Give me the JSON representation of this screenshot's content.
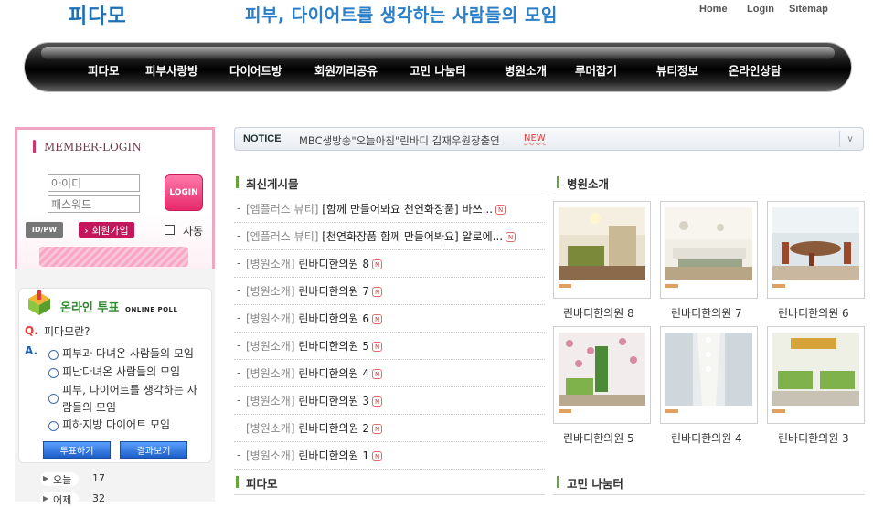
{
  "header": {
    "logo": "피다모",
    "slogan": "피부, 다이어트를 생각하는 사람들의 모임",
    "links": [
      "Home",
      "Login",
      "Sitemap"
    ]
  },
  "nav": [
    "피다모",
    "피부사랑방",
    "다이어트방",
    "회원끼리공유",
    "고민 나눔터",
    "병원소개",
    "루머잡기",
    "뷰티정보",
    "온라인상담"
  ],
  "login": {
    "title": "MEMBER-LOGIN",
    "id_placeholder": "아이디",
    "pw_placeholder": "패스워드",
    "login_button": "LOGIN",
    "idpw_button": "ID/PW",
    "join_button": "› 회원가입",
    "auto_label": "자동"
  },
  "poll": {
    "title": "온라인 투표",
    "subtitle": "ONLINE POLL",
    "q_mark": "Q.",
    "a_mark": "A.",
    "question": "피다모란?",
    "options": [
      "피부과 다녀온 사람들의 모임",
      "피난다녀온 사람들의 모임",
      "피부, 다이어트를 생각하는 사",
      "람들의 모임",
      "피하지방 다이어트 모임"
    ],
    "vote_button": "투표하기",
    "result_button": "결과보기"
  },
  "stats": {
    "today_label": "오늘",
    "today_value": "17",
    "yesterday_label": "어제",
    "yesterday_value": "32"
  },
  "notice": {
    "label": "NOTICE",
    "text": "MBC생방송\"오늘아침\"린바디 김재우원장출연",
    "new": "NEW",
    "dropdown": "∨"
  },
  "recent": {
    "title": "최신게시물",
    "new_badge": "N",
    "posts": [
      {
        "cat": "[엠플러스 뷰티]",
        "title": "[함께 만들어봐요 천연화장품] 바쓰..."
      },
      {
        "cat": "[엠플러스 뷰티]",
        "title": "[천연화장품 함께 만들어봐요] 알로에..."
      },
      {
        "cat": "[병원소개]",
        "title": "린바디한의원 8"
      },
      {
        "cat": "[병원소개]",
        "title": "린바디한의원 7"
      },
      {
        "cat": "[병원소개]",
        "title": "린바디한의원 6"
      },
      {
        "cat": "[병원소개]",
        "title": "린바디한의원 5"
      },
      {
        "cat": "[병원소개]",
        "title": "린바디한의원 4"
      },
      {
        "cat": "[병원소개]",
        "title": "린바디한의원 3"
      },
      {
        "cat": "[병원소개]",
        "title": "린바디한의원 2"
      },
      {
        "cat": "[병원소개]",
        "title": "린바디한의원 1"
      }
    ]
  },
  "hospital": {
    "title": "병원소개",
    "items": [
      "린바디한의원 8",
      "린바디한의원 7",
      "린바디한의원 6",
      "린바디한의원 5",
      "린바디한의원 4",
      "린바디한의원 3"
    ]
  },
  "bottom_sections": {
    "left": "피다모",
    "right": "고민 나눔터"
  }
}
